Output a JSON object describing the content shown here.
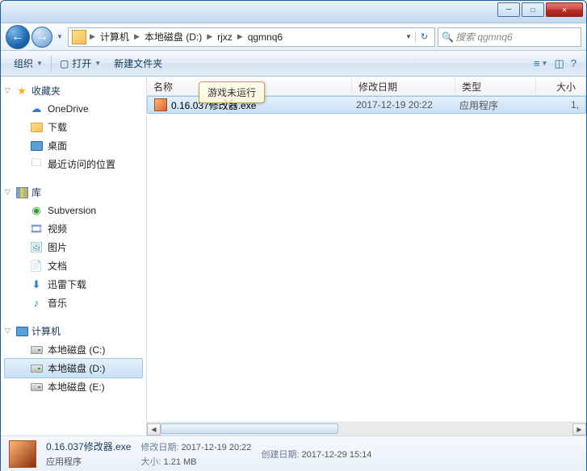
{
  "breadcrumb": {
    "segments": [
      "计算机",
      "本地磁盘 (D:)",
      "rjxz",
      "qgmnq6"
    ]
  },
  "search": {
    "placeholder": "搜索 qgmnq6"
  },
  "toolbar": {
    "organize": "组织",
    "open": "打开",
    "newfolder": "新建文件夹"
  },
  "sidebar": {
    "favorites": {
      "label": "收藏夹",
      "items": [
        {
          "icon": "cloud",
          "label": "OneDrive"
        },
        {
          "icon": "download",
          "label": "下载"
        },
        {
          "icon": "desktop",
          "label": "桌面"
        },
        {
          "icon": "recent",
          "label": "最近访问的位置"
        }
      ]
    },
    "libraries": {
      "label": "库",
      "items": [
        {
          "icon": "svn",
          "label": "Subversion"
        },
        {
          "icon": "video",
          "label": "视频"
        },
        {
          "icon": "pictures",
          "label": "图片"
        },
        {
          "icon": "docs",
          "label": "文档"
        },
        {
          "icon": "xunlei",
          "label": "迅雷下载"
        },
        {
          "icon": "music",
          "label": "音乐"
        }
      ]
    },
    "computer": {
      "label": "计算机",
      "items": [
        {
          "icon": "drive",
          "label": "本地磁盘 (C:)"
        },
        {
          "icon": "drive",
          "label": "本地磁盘 (D:)",
          "selected": true
        },
        {
          "icon": "drive",
          "label": "本地磁盘 (E:)"
        }
      ]
    }
  },
  "columns": {
    "name": "名称",
    "date": "修改日期",
    "type": "类型",
    "size": "大小"
  },
  "files": [
    {
      "name": "0.16.037修改器.exe",
      "date": "2017-12-19 20:22",
      "type": "应用程序",
      "size": "1,",
      "selected": true
    }
  ],
  "tooltip": "游戏未运行",
  "details": {
    "filename": "0.16.037修改器.exe",
    "filetype": "应用程序",
    "modLabel": "修改日期:",
    "modValue": "2017-12-19 20:22",
    "createLabel": "创建日期:",
    "createValue": "2017-12-29 15:14",
    "sizeLabel": "大小:",
    "sizeValue": "1.21 MB"
  }
}
